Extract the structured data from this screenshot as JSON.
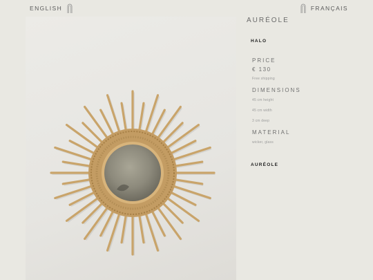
{
  "header": {
    "lang_en": "ENGLISH",
    "lang_fr": "FRANÇAIS"
  },
  "product": {
    "title": "AURÉOLE",
    "subtitle": "HALO",
    "price_label": "PRICE",
    "price": "€ 130",
    "shipping": "Free shipping",
    "dimensions_label": "DIMENSIONS",
    "dimensions": [
      "45 cm height",
      "45 cm width",
      "3 cm deep"
    ],
    "material_label": "MATERIAL",
    "material": "wicker, glass",
    "collection_link": "AURÉOLE"
  },
  "image": {
    "subject": "sunburst wicker mirror"
  },
  "colors": {
    "background": "#e9e8e2",
    "wicker": "#c9a46a",
    "text_dark": "#222222"
  }
}
